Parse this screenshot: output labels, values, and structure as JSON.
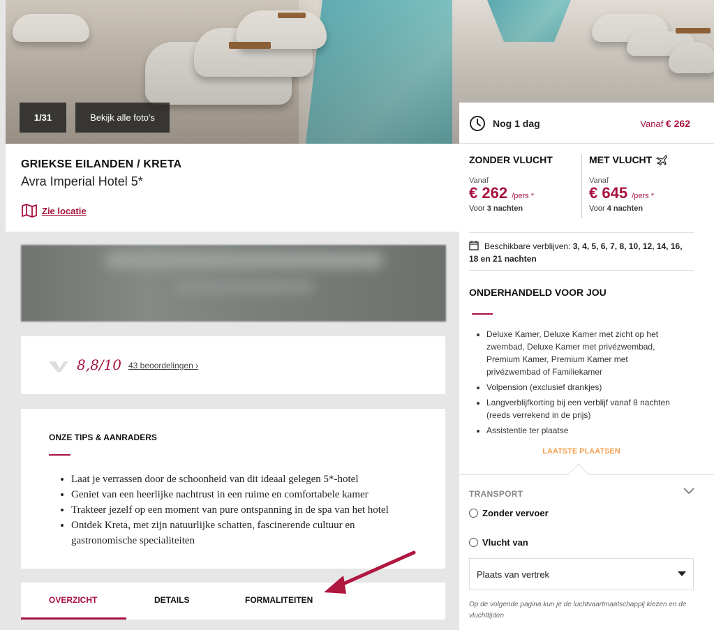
{
  "gallery": {
    "counter": "1/31",
    "all_photos": "Bekijk alle foto's"
  },
  "hotel": {
    "region": "GRIEKSE EILANDEN / KRETA",
    "name": "Avra Imperial Hotel 5*",
    "location_link": "Zie locatie"
  },
  "rating": {
    "score": "8,8/10",
    "reviews": "43 beoordelingen"
  },
  "tips": {
    "title": "ONZE TIPS & AANRADERS",
    "items": [
      "Laat je verrassen door de schoonheid van dit ideaal gelegen 5*-hotel",
      "Geniet van een heerlijke nachtrust in een ruime en comfortabele kamer",
      "Trakteer jezelf op een moment van pure ontspanning in de spa van het hotel",
      "Ontdek Kreta, met zijn natuurlijke schatten, fascinerende cultuur en gastronomische specialiteiten"
    ]
  },
  "tabs": [
    "OVERZICHT",
    "DETAILS",
    "FORMALITEITEN"
  ],
  "panel": {
    "countdown": "Nog 1 dag",
    "vanaf_label": "Vanaf",
    "vanaf_price": "€ 262",
    "options": [
      {
        "title": "ZONDER VLUCHT",
        "from": "Vanaf",
        "price": "€ 262",
        "per": "/pers *",
        "nights_prefix": "Voor",
        "nights": "3 nachten"
      },
      {
        "title": "MET VLUCHT",
        "from": "Vanaf",
        "price": "€ 645",
        "per": "/pers *",
        "nights_prefix": "Voor",
        "nights": "4 nachten"
      }
    ],
    "availability_label": "Beschikbare verblijven:",
    "availability_values": "3, 4, 5, 6, 7, 8, 10, 12, 14, 16, 18 en 21 nachten",
    "deal_title": "ONDERHANDELD VOOR JOU",
    "deal_items": [
      "Deluxe Kamer, Deluxe Kamer met zicht op het zwembad, Deluxe Kamer met privézwembad, Premium Kamer, Premium Kamer met privézwembad of Familiekamer",
      "Volpension (exclusief drankjes)",
      "Langverblijfkorting bij een verblijf vanaf 8 nachten (reeds verrekend in de prijs)",
      "Assistentie ter plaatse"
    ],
    "last_places": "LAATSTE PLAATSEN",
    "transport": {
      "title": "TRANSPORT",
      "option1": "Zonder vervoer",
      "option2": "Vlucht van",
      "select_value": "Plaats van vertrek",
      "note": "Op de volgende pagina kun je de luchtvaartmaatschappij kiezen en de vluchttijden"
    }
  },
  "colors": {
    "brand": "#a8123e",
    "accent": "#f0a050"
  }
}
